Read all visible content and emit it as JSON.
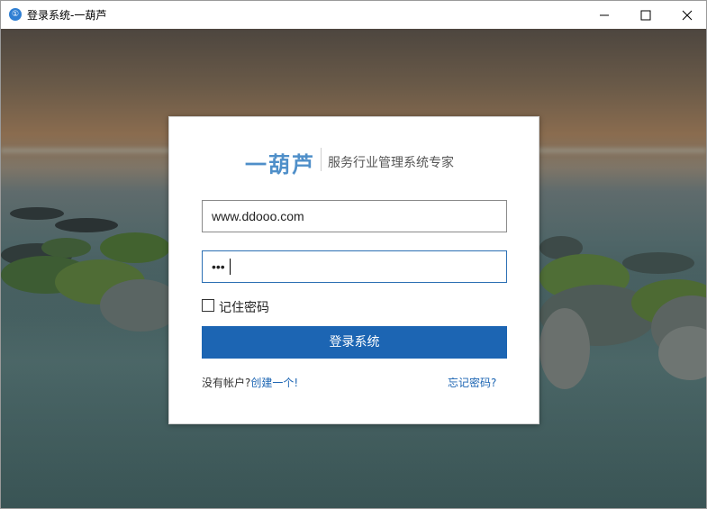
{
  "window": {
    "title": "登录系统-一葫芦",
    "app_icon_glyph": "①",
    "controls": [
      "minimize",
      "maximize",
      "close"
    ]
  },
  "login": {
    "brand": "一葫芦",
    "slogan": "服务行业管理系统专家",
    "username_value": "www.ddooo.com",
    "password_masked": "•••",
    "remember_label": "记住密码",
    "remember_checked": false,
    "submit_label": "登录系统",
    "signup_prefix": "没有帐户?",
    "signup_link": "创建一个!",
    "forgot_link": "忘记密码?"
  },
  "colors": {
    "brand": "#4f8fc9",
    "primary_button": "#1c65b3",
    "link": "#1c65b3",
    "focus_border": "#2b6fb3"
  },
  "icons": {
    "app": "app-icon",
    "minimize": "minimize-icon",
    "maximize": "maximize-icon",
    "close": "close-icon"
  }
}
